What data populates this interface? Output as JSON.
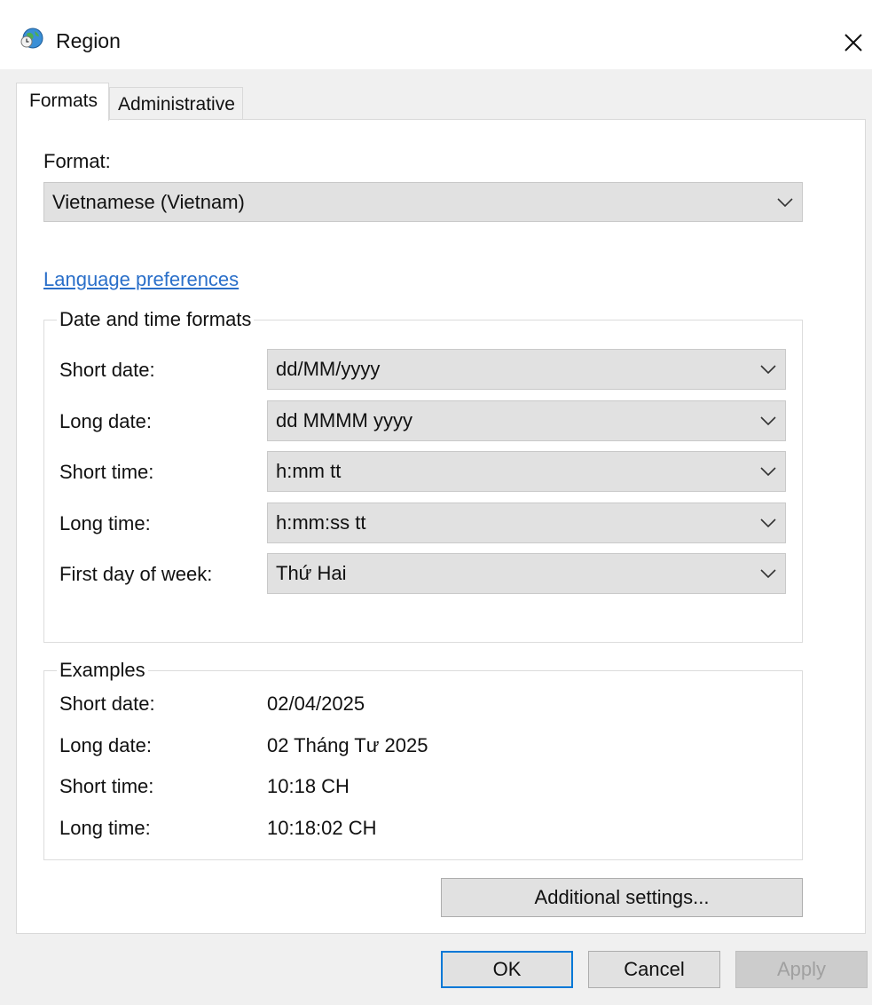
{
  "window": {
    "title": "Region"
  },
  "tabs": [
    {
      "label": "Formats"
    },
    {
      "label": "Administrative"
    }
  ],
  "format": {
    "label": "Format:",
    "value": "Vietnamese (Vietnam)"
  },
  "language_link": "Language preferences",
  "date_time": {
    "title": "Date and time formats",
    "rows": [
      {
        "label": "Short date:",
        "value": "dd/MM/yyyy"
      },
      {
        "label": "Long date:",
        "value": "dd MMMM yyyy"
      },
      {
        "label": "Short time:",
        "value": "h:mm tt"
      },
      {
        "label": "Long time:",
        "value": "h:mm:ss tt"
      },
      {
        "label": "First day of week:",
        "value": "Thứ Hai"
      }
    ]
  },
  "examples": {
    "title": "Examples",
    "rows": [
      {
        "label": "Short date:",
        "value": "02/04/2025"
      },
      {
        "label": "Long date:",
        "value": "02 Tháng Tư 2025"
      },
      {
        "label": "Short time:",
        "value": "10:18 CH"
      },
      {
        "label": "Long time:",
        "value": "10:18:02 CH"
      }
    ]
  },
  "buttons": {
    "additional": "Additional settings...",
    "ok": "OK",
    "cancel": "Cancel",
    "apply": "Apply"
  },
  "icons": {
    "app": "globe-clock-icon",
    "close": "close-icon",
    "dropdown": "chevron-down-icon"
  },
  "colors": {
    "link": "#2a6fc9",
    "focus_border": "#0078d7"
  }
}
